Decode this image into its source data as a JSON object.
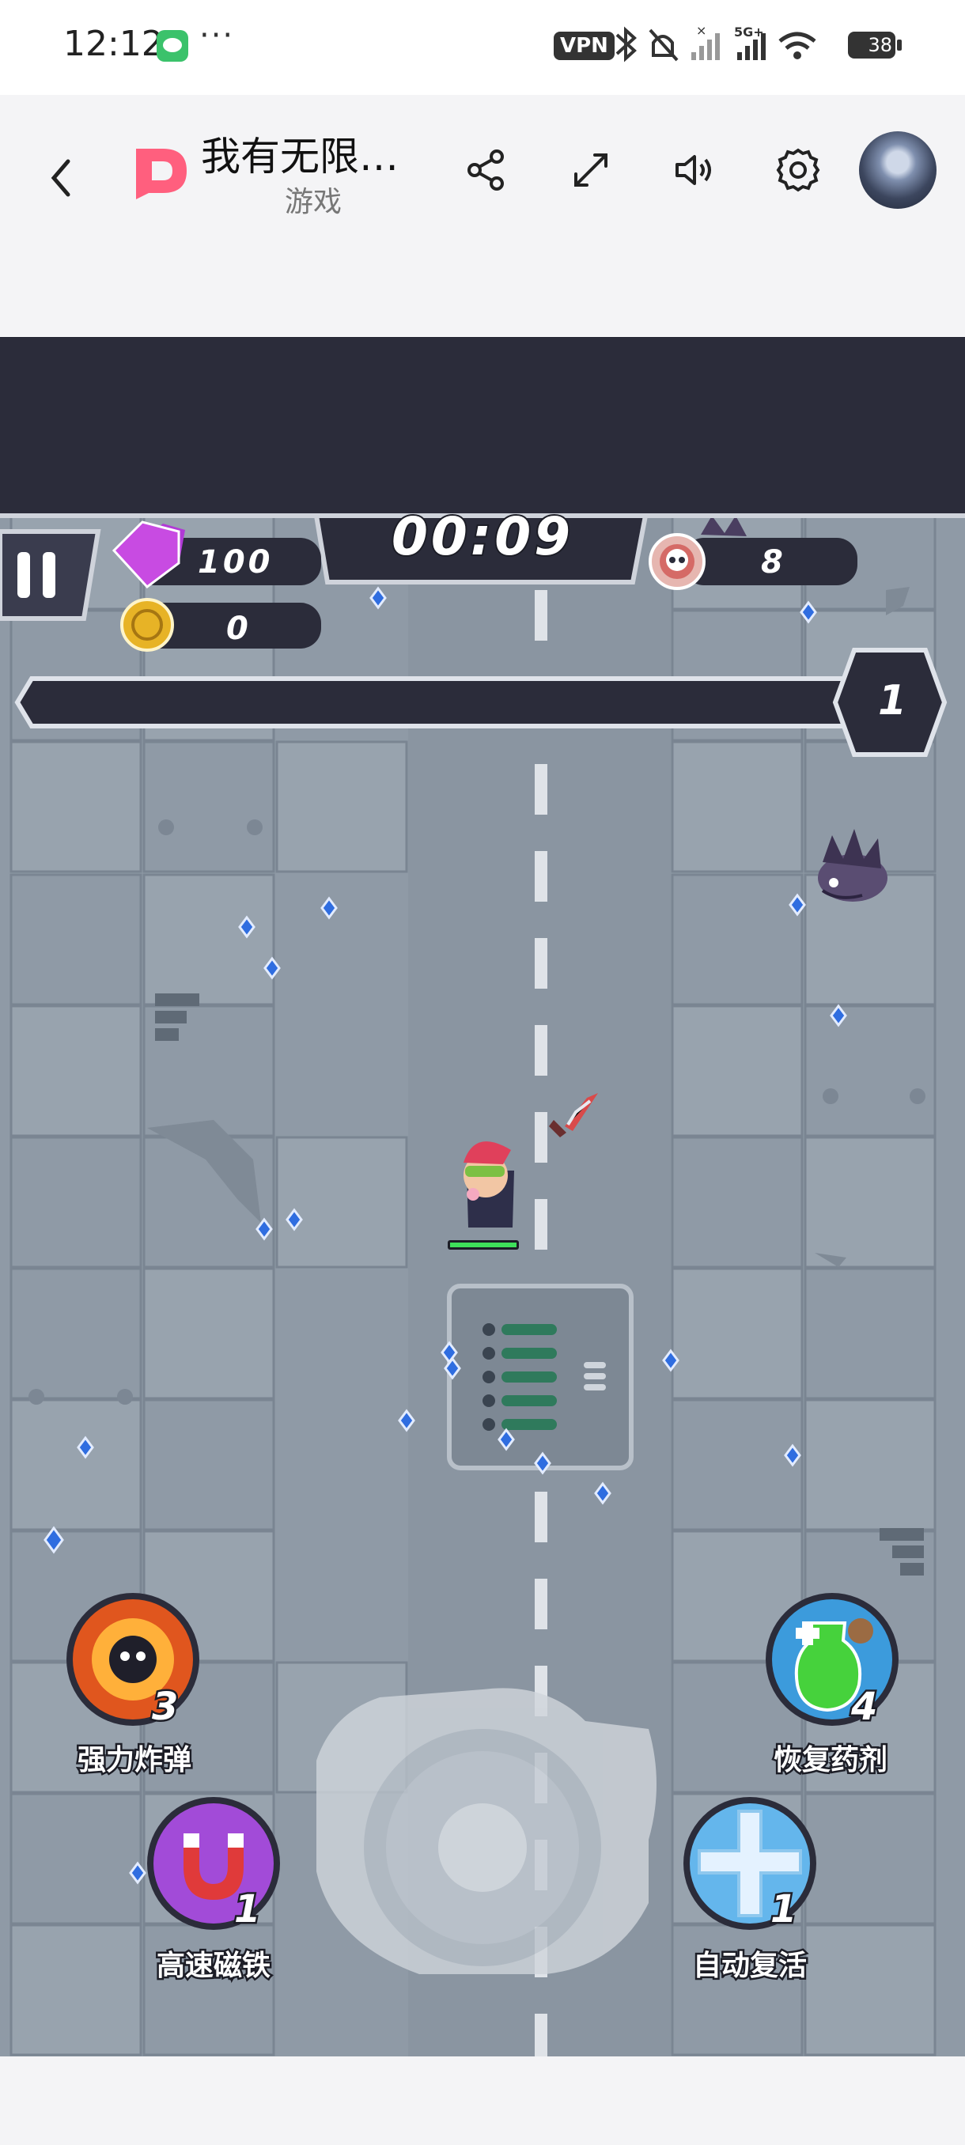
{
  "status_bar": {
    "time": "12:12",
    "more": "···",
    "vpn": "VPN",
    "network": "5G+",
    "battery": "38",
    "icons": [
      "wechat-icon",
      "bluetooth-icon",
      "mute-bell-icon",
      "signal-icon",
      "wifi-icon",
      "battery-icon"
    ]
  },
  "header": {
    "title": "我有无限…",
    "subtitle": "游戏",
    "buttons": [
      "back-icon",
      "share-icon",
      "fullscreen-icon",
      "sound-icon",
      "settings-icon",
      "avatar"
    ],
    "logo_color": "#ff5f7e"
  },
  "game": {
    "timer": "00:09",
    "gems": "100",
    "coins": "0",
    "kills": "8",
    "level": "1",
    "xp_progress": 0.0,
    "skills": [
      {
        "id": "bomb",
        "label": "强力炸弹",
        "count": "3"
      },
      {
        "id": "potion",
        "label": "恢复药剂",
        "count": "4"
      },
      {
        "id": "magnet",
        "label": "高速磁铁",
        "count": "1"
      },
      {
        "id": "revive",
        "label": "自动复活",
        "count": "1"
      }
    ],
    "colors": {
      "hud_dark": "#2b2c3a",
      "floor": "#8f9aa6",
      "gem_blue": "#2f6de0",
      "hp_green": "#3ee05a"
    }
  }
}
